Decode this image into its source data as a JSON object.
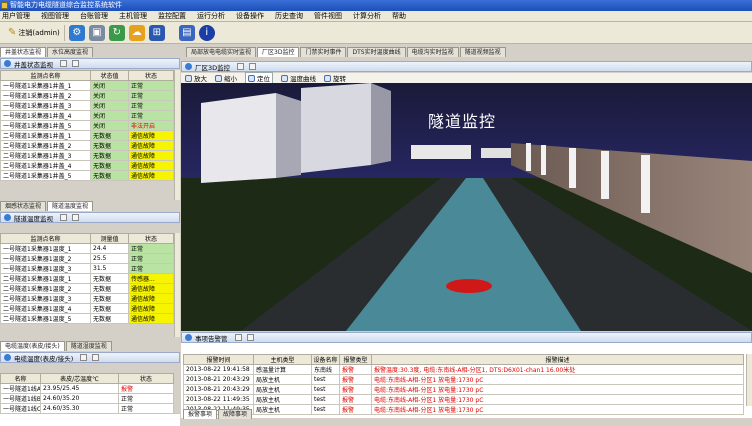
{
  "app": {
    "title": "智能电力电缆隧道综合监控系统软件"
  },
  "menu": [
    "用户管理",
    "视图管理",
    "台账管理",
    "主机管理",
    "监控配置",
    "运行分析",
    "设备操作",
    "历史查询",
    "管件视图",
    "计算分析",
    "帮助"
  ],
  "toolbar": {
    "logout_label": "注销(admin)"
  },
  "left_top": {
    "tabs": [
      "井盖状态监视",
      "水位高度监视"
    ],
    "header": "井盖状态监视",
    "columns": [
      "监测点名称",
      "状态值",
      "状态"
    ],
    "rows": [
      {
        "name": "一号隧道1采集器1井盖_1",
        "value": "关闭",
        "status": "正常",
        "vclass": "green",
        "sclass": "green"
      },
      {
        "name": "一号隧道1采集器1井盖_2",
        "value": "关闭",
        "status": "正常",
        "vclass": "green",
        "sclass": "green"
      },
      {
        "name": "一号隧道1采集器1井盖_3",
        "value": "关闭",
        "status": "正常",
        "vclass": "green",
        "sclass": "green"
      },
      {
        "name": "一号隧道1采集器1井盖_4",
        "value": "关闭",
        "status": "正常",
        "vclass": "green",
        "sclass": "green"
      },
      {
        "name": "一号隧道1采集器1井盖_5",
        "value": "关闭",
        "status": "非法开启",
        "vclass": "green",
        "sclass": "red"
      },
      {
        "name": "二号隧道1采集器1井盖_1",
        "value": "无数据",
        "status": "通信故障",
        "vclass": "green",
        "sclass": "yellow"
      },
      {
        "name": "二号隧道1采集器1井盖_2",
        "value": "无数据",
        "status": "通信故障",
        "vclass": "green",
        "sclass": "yellow"
      },
      {
        "name": "二号隧道1采集器1井盖_3",
        "value": "无数据",
        "status": "通信故障",
        "vclass": "green",
        "sclass": "yellow"
      },
      {
        "name": "二号隧道1采集器1井盖_4",
        "value": "无数据",
        "status": "通信故障",
        "vclass": "green",
        "sclass": "yellow"
      },
      {
        "name": "二号隧道1采集器1井盖_5",
        "value": "无数据",
        "status": "通信故障",
        "vclass": "green",
        "sclass": "yellow"
      }
    ]
  },
  "left_mid": {
    "tabs": [
      "烟感状态监视",
      "隧道温度监视"
    ],
    "header": "隧道温度监视",
    "columns": [
      "监测点名称",
      "测量值",
      "状态"
    ],
    "rows": [
      {
        "name": "一号隧道1采集器1温度_1",
        "value": "24.4",
        "status": "正常",
        "sclass": "green"
      },
      {
        "name": "一号隧道1采集器1温度_2",
        "value": "25.5",
        "status": "正常",
        "sclass": "green"
      },
      {
        "name": "一号隧道1采集器1温度_3",
        "value": "31.5",
        "status": "正常",
        "sclass": "green"
      },
      {
        "name": "二号隧道1采集器1温度_1",
        "value": "无数据",
        "status": "传感器...",
        "sclass": "yellow"
      },
      {
        "name": "二号隧道1采集器1温度_2",
        "value": "无数据",
        "status": "通信故障",
        "sclass": "yellow"
      },
      {
        "name": "二号隧道1采集器1温度_3",
        "value": "无数据",
        "status": "通信故障",
        "sclass": "yellow"
      },
      {
        "name": "二号隧道1采集器1温度_4",
        "value": "无数据",
        "status": "通信故障",
        "sclass": "yellow"
      },
      {
        "name": "二号隧道1采集器1温度_5",
        "value": "无数据",
        "status": "通信故障",
        "sclass": "yellow"
      }
    ]
  },
  "left_bot": {
    "tabs": [
      "电缆温度(表皮/接头)",
      "隧道湿度监视"
    ],
    "header": "电缆温度(表皮/接头)",
    "columns": [
      "名称",
      "表皮/芯温度℃",
      "状态"
    ],
    "rows": [
      {
        "name": "一号隧道1线A相",
        "value": "23.95/25.45",
        "status": "报警",
        "sclass": "red-txt"
      },
      {
        "name": "一号隧道1线B相",
        "value": "24.60/35.20",
        "status": "正常",
        "sclass": ""
      },
      {
        "name": "一号隧道1线C相",
        "value": "24.60/35.30",
        "status": "正常",
        "sclass": ""
      }
    ]
  },
  "top_tabs": [
    "局部放电电缆实时监视",
    "厂区3D监控",
    "门禁实时事件",
    "DTS实时温度曲线",
    "电缆沟实时监视",
    "隧道视频监视"
  ],
  "top_tab_active": 1,
  "viewer": {
    "header": "厂区3D监控",
    "buttons": [
      "放大",
      "缩小",
      "定位",
      "温度曲线",
      "旋转"
    ],
    "scene_title": "隧道监控"
  },
  "events": {
    "header": "事项告警管",
    "columns": [
      "报警时间",
      "主机类型",
      "设备名称",
      "报警类型",
      "报警描述"
    ],
    "rows": [
      {
        "time": "2013-08-22 19:41:58",
        "host": "感温量计算",
        "device": "东南线",
        "type": "报警",
        "desc": "报警温度:30.3度, 电缆:东南线-A相-分区1, DTS:D6X01-chan1 16.00米处"
      },
      {
        "time": "2013-08-21 20:43:29",
        "host": "局放主机",
        "device": "test",
        "type": "报警",
        "desc": "电缆:东南线-A相-分区1 放电量:1730 pC"
      },
      {
        "time": "2013-08-21 20:43:29",
        "host": "局放主机",
        "device": "test",
        "type": "报警",
        "desc": "电缆:东南线-A相-分区1 放电量:1730 pC"
      },
      {
        "time": "2013-08-22 11:49:35",
        "host": "局放主机",
        "device": "test",
        "type": "报警",
        "desc": "电缆:东南线-A相-分区1 放电量:1730 pC"
      },
      {
        "time": "2013-08-22 11:49:35",
        "host": "局放主机",
        "device": "test",
        "type": "报警",
        "desc": "电缆:东南线-A相-分区1 放电量:1730 pC"
      }
    ],
    "bottom_tabs": [
      "报警事项",
      "故障事项"
    ]
  }
}
